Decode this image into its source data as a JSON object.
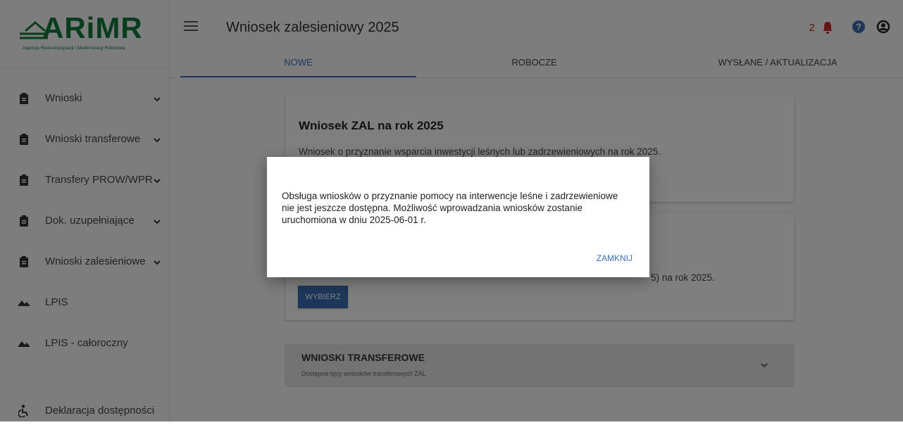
{
  "logo": {
    "text": "ARiMR",
    "subtitle": "Agencja Restrukturyzacji i Modernizacji Rolnictwa"
  },
  "header": {
    "title": "Wniosek zalesieniowy 2025",
    "notification_count": "2",
    "icons": [
      "menu-icon",
      "bell-icon",
      "help-icon",
      "account-icon"
    ]
  },
  "tabs": [
    {
      "label": "NOWE",
      "active": true
    },
    {
      "label": "ROBOCZE",
      "active": false
    },
    {
      "label": "WYSŁANE / AKTUALIZACJA",
      "active": false
    }
  ],
  "sidebar": {
    "items": [
      {
        "label": "Wnioski",
        "icon": "clipboard-icon",
        "expandable": true
      },
      {
        "label": "Wnioski transferowe",
        "icon": "clipboard-icon",
        "expandable": true
      },
      {
        "label": "Transfery PROW/WPR",
        "icon": "clipboard-icon",
        "expandable": true
      },
      {
        "label": "Dok. uzupełniające",
        "icon": "clipboard-icon",
        "expandable": true
      },
      {
        "label": "Wnioski zalesieniowe",
        "icon": "clipboard-icon",
        "expandable": true
      },
      {
        "label": "LPIS",
        "icon": "terrain-icon",
        "expandable": false
      },
      {
        "label": "LPIS - całoroczny",
        "icon": "terrain-icon",
        "expandable": false
      },
      {
        "label": "Deklaracja dostępności",
        "icon": "accessibility-icon",
        "expandable": false
      }
    ]
  },
  "main": {
    "card1": {
      "title": "Wniosek ZAL na rok 2025",
      "description": "Wniosek o przyznanie wsparcia inwestycji leśnych lub zadrzewieniowych na rok 2025."
    },
    "card2": {
      "description_visible": "5) na rok 2025.",
      "button": "WYBIERZ"
    },
    "accordion": {
      "title": "WNIOSKI TRANSFEROWE",
      "subtitle": "Dostępne typy wniosków transferowych ZAL"
    }
  },
  "modal": {
    "message": "Obsługa wniosków o przyznanie pomocy na interwencje leśne i zadrzewieniowe nie jest jeszcze dostępna. Możliwość wprowadzania wniosków zostanie uruchomiona w dniu 2025-06-01 r.",
    "close_label": "ZAMKNIJ"
  },
  "colors": {
    "brand_green": "#0f7a3a",
    "accent_blue": "#3b6fb6",
    "alert_red": "#c62828"
  }
}
